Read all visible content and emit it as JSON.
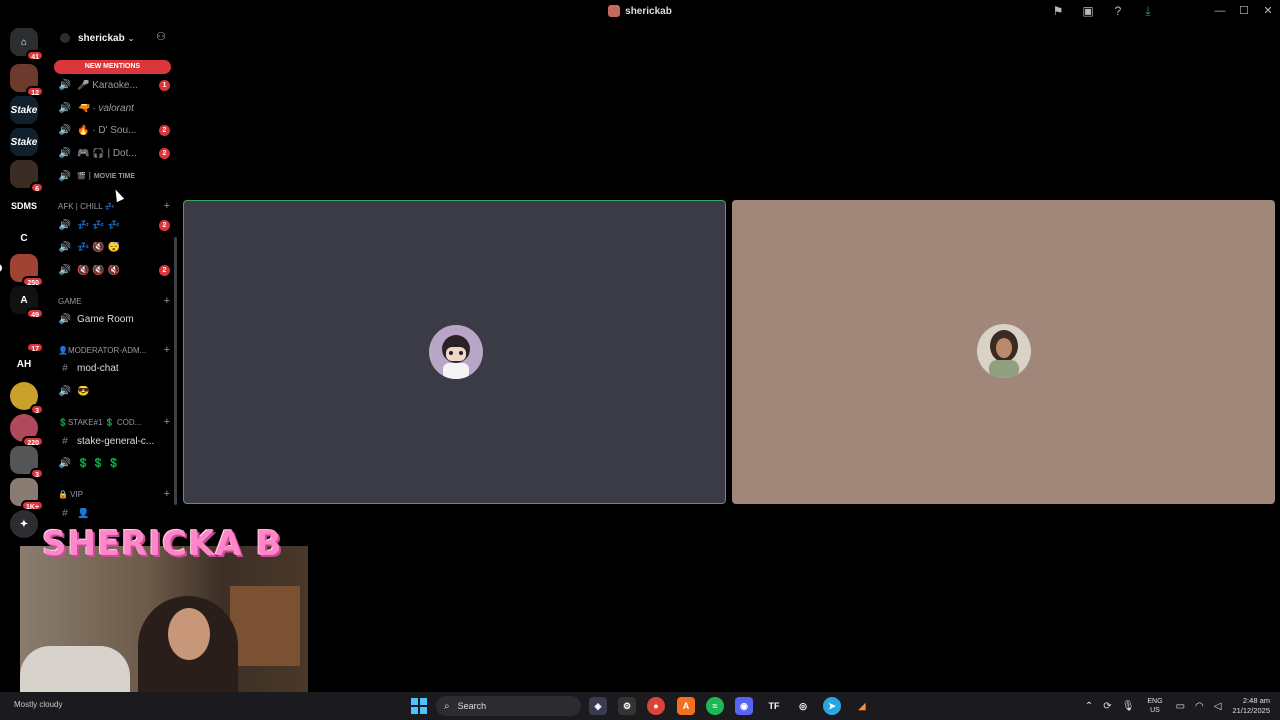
{
  "window": {
    "title": "sherickab",
    "controls": [
      "—",
      "☐",
      "✕"
    ]
  },
  "titlebar_icons": [
    "inbox-icon",
    "screen-icon",
    "help-icon",
    "download-icon"
  ],
  "guilds": [
    {
      "label": "",
      "badge": "41",
      "icon": "discord-home-icon"
    },
    {
      "label": "",
      "badge": "12"
    },
    {
      "label": "Stake",
      "badge": ""
    },
    {
      "label": "Stake",
      "badge": ""
    },
    {
      "label": "",
      "badge": "6"
    },
    {
      "label": "SDMS",
      "badge": ""
    },
    {
      "label": "C",
      "badge": ""
    },
    {
      "label": "",
      "badge": "250"
    },
    {
      "label": "A",
      "badge": "49"
    },
    {
      "label": "",
      "badge": "17"
    },
    {
      "label": "AH",
      "badge": ""
    },
    {
      "label": "",
      "badge": "3"
    },
    {
      "label": "",
      "badge": "220"
    },
    {
      "label": "",
      "badge": "3"
    },
    {
      "label": "",
      "badge": "1K+"
    },
    {
      "label": "",
      "badge": ""
    }
  ],
  "server": {
    "name": "sherickab",
    "new_mentions": "NEW MENTIONS"
  },
  "channels": [
    {
      "icon": "voice",
      "label": "🎤 Karaoke...",
      "mention": "1"
    },
    {
      "icon": "voice",
      "label": "🔫 · valorant",
      "mention": "",
      "style": "italic"
    },
    {
      "icon": "voice",
      "label": "🔥 · D' Sou...",
      "mention": "2"
    },
    {
      "icon": "voice",
      "label": "🎮 🎧 | Dot...",
      "mention": "2"
    },
    {
      "icon": "voice",
      "label": "🎬 ┊ MOVIE TIME",
      "mention": "",
      "style": "small"
    }
  ],
  "categories": [
    {
      "label": "AFK | CHILL 💤"
    },
    {
      "label": "GAME"
    },
    {
      "label": "👤Moderator-Adm..."
    },
    {
      "label": "💲STAKE#1 💲 cod..."
    },
    {
      "label": "🔒 VIP"
    }
  ],
  "afk_channels": [
    {
      "label": "💤 💤 💤",
      "mention": "2"
    },
    {
      "label": "💤 🔇 😴",
      "mention": ""
    },
    {
      "label": "🔇 🔇 🔇",
      "mention": "2"
    }
  ],
  "game_channels": [
    {
      "label": "Game Room"
    }
  ],
  "mod_channels": [
    {
      "label": "mod-chat"
    },
    {
      "label": "😎"
    }
  ],
  "stake_channels": [
    {
      "label": "stake-general-c..."
    },
    {
      "label": "💲 💲 💲"
    }
  ],
  "vip_channels": [
    {
      "label": "👤"
    }
  ],
  "webcam": {
    "banner": "SHERICKA B"
  },
  "taskbar": {
    "weather": "Mostly cloudy",
    "search_placeholder": "Search",
    "lang_top": "ENG",
    "lang_bottom": "US",
    "time": "2:48 am",
    "date": "21/12/2025"
  },
  "colors": {
    "speaking_border": "#3ba55d",
    "mention_red": "#da373c",
    "tile_left": "#3a3b44",
    "tile_right": "#a0877a"
  }
}
